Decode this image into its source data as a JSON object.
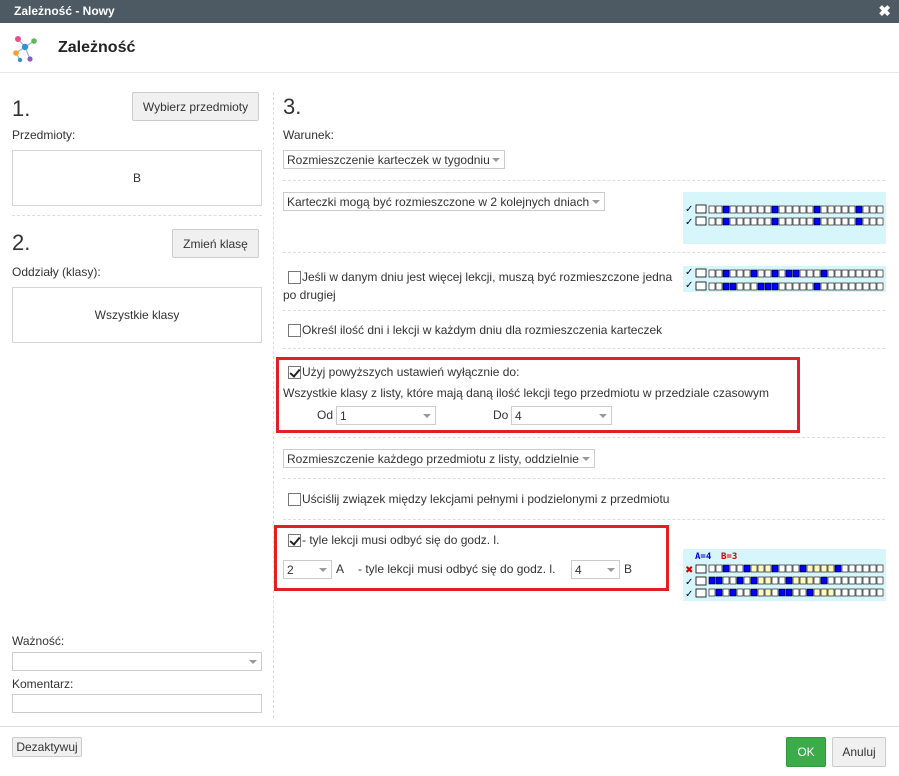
{
  "window": {
    "title": "Zależność - Nowy",
    "close_icon": "close-icon"
  },
  "header": {
    "title": "Zależność",
    "icon": "molecule-icon"
  },
  "left": {
    "step1": {
      "number": "1.",
      "button": "Wybierz przedmioty",
      "label": "Przedmioty:",
      "value": "B"
    },
    "step2": {
      "number": "2.",
      "button": "Zmień klasę",
      "label": "Oddziały (klasy):",
      "value": "Wszystkie klasy"
    },
    "importance": {
      "label": "Ważność:",
      "value": ""
    },
    "comment": {
      "label": "Komentarz:",
      "value": ""
    }
  },
  "right": {
    "number": "3.",
    "condition_label": "Warunek:",
    "condition_value": "Rozmieszczenie karteczek w tygodniu",
    "spread_value": "Karteczki mogą być rozmieszczone w 2 kolejnych dniach",
    "consecutive_label": "Jeśli w danym dniu jest więcej lekcji, muszą być rozmieszczone jedna po drugiej",
    "consecutive_checked": false,
    "specify_days_label": "Określ ilość dni i lekcji w każdym dniu dla rozmieszczenia karteczek",
    "specify_days_checked": false,
    "only_for_label": "Użyj powyższych ustawień wyłącznie do:",
    "only_for_checked": true,
    "only_for_desc": "Wszystkie klasy z listy, które mają daną ilość lekcji tego przedmiotu w przedziale czasowym",
    "from_label": "Od",
    "from_value": "1",
    "to_label": "Do",
    "to_value": "4",
    "placement_value": "Rozmieszczenie każdego przedmiotu z listy, oddzielnie",
    "full_split_label": "Uściślij związek między lekcjami pełnymi i podzielonymi z przedmiotu",
    "full_split_checked": false,
    "period_checkbox_label": "- tyle lekcji musi odbyć się do godz. l.",
    "period_checked": true,
    "a_value": "2",
    "a_label": "A",
    "b_desc": "- tyle lekcji musi odbyć się do godz. l.",
    "b_value": "4",
    "b_label": "B",
    "thumb3_legend_a": "A=4",
    "thumb3_legend_b": "B=3"
  },
  "footer": {
    "deactivate": "Dezaktywuj",
    "ok": "OK",
    "cancel": "Anuluj"
  },
  "colors": {
    "titlebar": "#4d5a64",
    "ok": "#3cab4a",
    "highlight": "#e21f26",
    "thumb_bg": "#d7f6fb",
    "cell_fill": "#0000ff"
  }
}
